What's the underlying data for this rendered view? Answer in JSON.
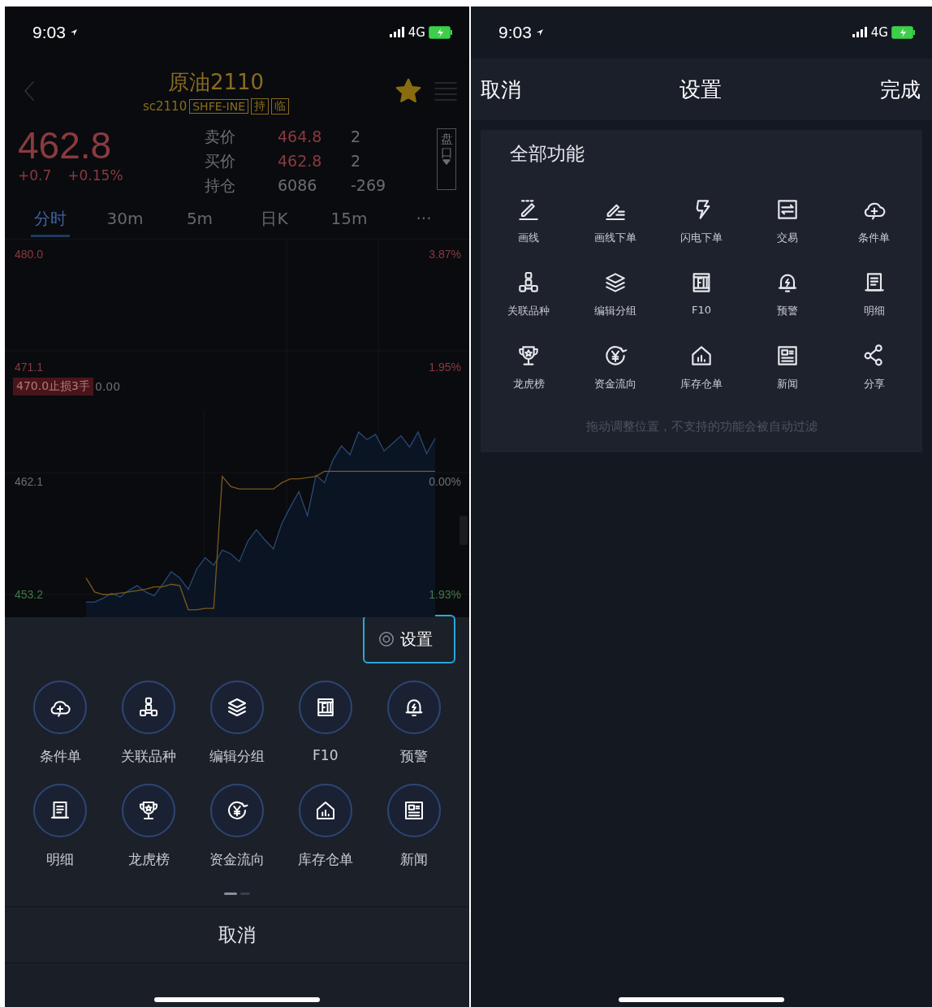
{
  "left_screen": {
    "status_bar": {
      "time": "9:03",
      "network": "4G"
    },
    "header": {
      "title": "原油2110",
      "code": "sc2110",
      "tags": [
        "SHFE-INE",
        "持",
        "临"
      ],
      "favorite": true
    },
    "quote": {
      "price": "462.8",
      "change": "+0.7",
      "change_percent": "+0.15%",
      "side_button": "盘口",
      "rows": [
        {
          "label": "卖价",
          "price": "464.8",
          "volume": "2"
        },
        {
          "label": "买价",
          "price": "462.8",
          "volume": "2"
        },
        {
          "label": "持仓",
          "price": "6086",
          "volume": "-269"
        }
      ]
    },
    "period_tabs": [
      {
        "label": "分时",
        "selected": true
      },
      {
        "label": "30m",
        "selected": false
      },
      {
        "label": "5m",
        "selected": false
      },
      {
        "label": "日K",
        "selected": false
      },
      {
        "label": "15m",
        "selected": false
      },
      {
        "label": "···",
        "selected": false
      }
    ],
    "chart": {
      "chart_data": {
        "type": "line",
        "ylim": [
          451.5,
          480.0
        ],
        "yticks": [
          {
            "value": 480.0,
            "label": "480.0"
          },
          {
            "value": 471.1,
            "label": "471.1"
          },
          {
            "value": 462.1,
            "label": "462.1"
          },
          {
            "value": 453.2,
            "label": "453.2"
          }
        ],
        "series": [
          {
            "color": "#2a4a78",
            "values": [
              452.6,
              452.6,
              452.9,
              453.3,
              453.0,
              453.5,
              453.9,
              453.4,
              453.1,
              454.0,
              455.0,
              454.5,
              453.6,
              455.2,
              456.1,
              455.5,
              456.7,
              456.4,
              455.8,
              457.4,
              458.3,
              457.5,
              456.8,
              458.8,
              460.1,
              461.3,
              459.4,
              462.6,
              462.0,
              463.8,
              464.9,
              464.2,
              466.0,
              465.4,
              465.8,
              464.5,
              465.1,
              465.7,
              464.8,
              466.0,
              464.3,
              465.5
            ]
          },
          {
            "color": "#7a5a1e",
            "values": [
              454.5,
              453.4,
              453.2,
              453.2,
              453.3,
              453.4,
              453.5,
              453.6,
              453.8,
              453.8,
              454.0,
              453.9,
              452.0,
              452.0,
              452.1,
              452.1,
              462.5,
              461.7,
              461.5,
              461.5,
              461.5,
              461.5,
              461.5,
              462.0,
              462.3,
              462.3,
              462.4,
              462.5,
              462.9,
              462.9,
              462.9,
              462.9,
              462.9,
              462.9,
              462.9,
              462.9,
              462.9,
              462.9,
              462.9,
              462.9,
              462.9,
              462.9
            ]
          }
        ]
      },
      "percent_labels": [
        "3.87%",
        "1.95%",
        "0.00%",
        "1.93%"
      ],
      "order_line": {
        "label": "470.0止损3手",
        "value": "0.00"
      }
    },
    "sheet": {
      "settings_button": "设置",
      "actions": [
        {
          "label": "条件单",
          "kind": "cloud"
        },
        {
          "label": "关联品种",
          "kind": "nodes"
        },
        {
          "label": "编辑分组",
          "kind": "layers"
        },
        {
          "label": "F10",
          "kind": "f10"
        },
        {
          "label": "预警",
          "kind": "bell"
        },
        {
          "label": "明细",
          "kind": "doc"
        },
        {
          "label": "龙虎榜",
          "kind": "trophy"
        },
        {
          "label": "资金流向",
          "kind": "yuan"
        },
        {
          "label": "库存仓单",
          "kind": "house"
        },
        {
          "label": "新闻",
          "kind": "news"
        }
      ],
      "page_dots": [
        {
          "selected": true
        },
        {
          "selected": false
        }
      ],
      "cancel": "取消"
    }
  },
  "right_screen": {
    "status_bar": {
      "time": "9:03",
      "network": "4G"
    },
    "nav": {
      "cancel": "取消",
      "title": "设置",
      "done": "完成"
    },
    "panel": {
      "title": "全部功能",
      "functions": [
        {
          "label": "画线",
          "kind": "pen"
        },
        {
          "label": "画线下单",
          "kind": "pen_order"
        },
        {
          "label": "闪电下单",
          "kind": "bolt"
        },
        {
          "label": "交易",
          "kind": "swap"
        },
        {
          "label": "条件单",
          "kind": "cloud"
        },
        {
          "label": "关联品种",
          "kind": "nodes"
        },
        {
          "label": "编辑分组",
          "kind": "layers"
        },
        {
          "label": "F10",
          "kind": "f10"
        },
        {
          "label": "预警",
          "kind": "bell"
        },
        {
          "label": "明细",
          "kind": "doc"
        },
        {
          "label": "龙虎榜",
          "kind": "trophy"
        },
        {
          "label": "资金流向",
          "kind": "yuan"
        },
        {
          "label": "库存仓单",
          "kind": "house"
        },
        {
          "label": "新闻",
          "kind": "news"
        },
        {
          "label": "分享",
          "kind": "share"
        }
      ],
      "hint": "拖动调整位置，不支持的功能会被自动过滤"
    }
  }
}
